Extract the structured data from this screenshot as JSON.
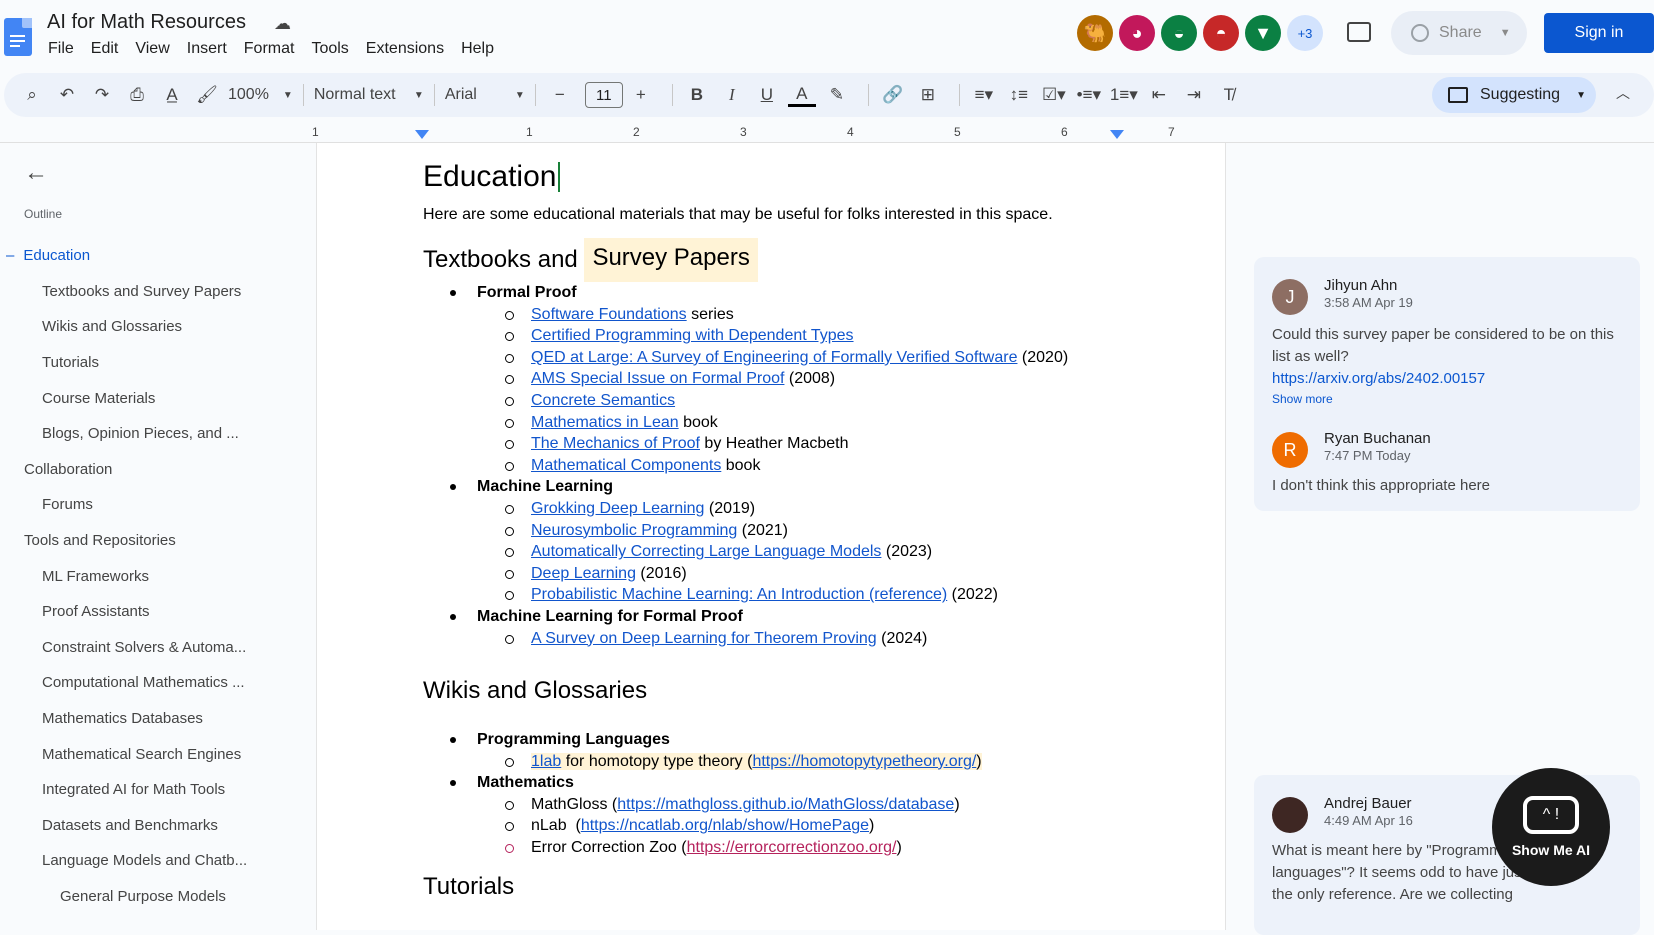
{
  "app": {
    "doc_title": "AI for Math Resources",
    "menu": [
      "File",
      "Edit",
      "View",
      "Insert",
      "Format",
      "Tools",
      "Extensions",
      "Help"
    ],
    "collaborators": [
      {
        "icon": "camel-avatar-icon",
        "color": "#b36b00"
      },
      {
        "icon": "axolotl-avatar-icon",
        "color": "#c2185b"
      },
      {
        "icon": "turtle-avatar-icon",
        "color": "#0b8043"
      },
      {
        "icon": "platypus-avatar-icon",
        "color": "#c62828"
      },
      {
        "icon": "fox-avatar-icon",
        "color": "#0b8043"
      }
    ],
    "more_collaborators": "+3",
    "share_label": "Share",
    "signin_label": "Sign in"
  },
  "toolbar": {
    "zoom": "100%",
    "style": "Normal text",
    "font": "Arial",
    "font_size": "11",
    "mode": "Suggesting"
  },
  "ruler": [
    "1",
    "1",
    "2",
    "3",
    "4",
    "5",
    "6",
    "7"
  ],
  "sidebar": {
    "outline_label": "Outline",
    "items": [
      {
        "label": "Education",
        "level": 1,
        "active": true
      },
      {
        "label": "Textbooks and Survey Papers",
        "level": 2
      },
      {
        "label": "Wikis and Glossaries",
        "level": 2
      },
      {
        "label": "Tutorials",
        "level": 2
      },
      {
        "label": "Course Materials",
        "level": 2
      },
      {
        "label": "Blogs, Opinion Pieces, and ...",
        "level": 2
      },
      {
        "label": "Collaboration",
        "level": 1
      },
      {
        "label": "Forums",
        "level": 2
      },
      {
        "label": "Tools and Repositories",
        "level": 1
      },
      {
        "label": "ML Frameworks",
        "level": 2
      },
      {
        "label": "Proof Assistants",
        "level": 2
      },
      {
        "label": "Constraint Solvers & Automa...",
        "level": 2
      },
      {
        "label": "Computational Mathematics ...",
        "level": 2
      },
      {
        "label": "Mathematics Databases",
        "level": 2
      },
      {
        "label": "Mathematical Search Engines",
        "level": 2
      },
      {
        "label": "Integrated AI for Math Tools",
        "level": 2
      },
      {
        "label": "Datasets and Benchmarks",
        "level": 2
      },
      {
        "label": "Language Models and Chatb...",
        "level": 2
      },
      {
        "label": "General Purpose Models",
        "level": 3
      }
    ]
  },
  "doc": {
    "heading": "Education",
    "intro": "Here are some educational materials that may be useful for folks interested in this space.",
    "section1": {
      "title_a": "Textbooks and ",
      "title_b": "Survey Papers",
      "formal_proof": {
        "label": "Formal Proof",
        "items": [
          {
            "link": "Software Foundations",
            "suffix": " series"
          },
          {
            "link": "Certified Programming with Dependent Types",
            "suffix": ""
          },
          {
            "link": "QED at Large: A Survey of Engineering of Formally Verified Software",
            "suffix": " (2020)"
          },
          {
            "link": "AMS Special Issue on Formal Proof",
            "suffix": " (2008)"
          },
          {
            "link": "Concrete Semantics",
            "suffix": ""
          },
          {
            "link": "Mathematics in Lean",
            "suffix": " book"
          },
          {
            "link": "The Mechanics of Proof",
            "suffix": " by Heather Macbeth"
          },
          {
            "link": "Mathematical Components",
            "suffix": " book"
          }
        ]
      },
      "ml": {
        "label": "Machine Learning",
        "items": [
          {
            "link": "Grokking Deep Learning",
            "suffix": " (2019)"
          },
          {
            "link": "Neurosymbolic Programming",
            "suffix": " (2021)"
          },
          {
            "link": "Automatically Correcting Large Language Models",
            "suffix": " (2023)"
          },
          {
            "link": "Deep Learning",
            "suffix": " (2016)"
          },
          {
            "link": "Probabilistic Machine Learning: An Introduction (reference)",
            "suffix": " (2022)"
          }
        ]
      },
      "mlfp": {
        "label": "Machine Learning for Formal Proof",
        "items": [
          {
            "link": "A Survey on Deep Learning for Theorem Proving",
            "suffix": " (2024)"
          }
        ]
      }
    },
    "section2": {
      "title": "Wikis and Glossaries",
      "pl": {
        "label": "Programming Languages",
        "item_link": "1lab",
        "item_mid": " for homotopy type theory (",
        "item_url": "https://homotopytypetheory.org/",
        "item_end": ")"
      },
      "math": {
        "label": "Mathematics",
        "items": [
          {
            "prefix": "MathGloss (",
            "url": "https://mathgloss.github.io/MathGloss/database",
            "end": ")"
          },
          {
            "prefix": "nLab  (",
            "url": "https://ncatlab.org/nlab/show/HomePage",
            "end": ")"
          },
          {
            "prefix": "Error Correction Zoo (",
            "url": "https://errorcorrectionzoo.org/",
            "end": ")",
            "suggestion": true
          }
        ]
      }
    },
    "next_heading_partial": "Tutorials"
  },
  "comments": [
    {
      "initial": "J",
      "name": "Jihyun Ahn",
      "time": "3:58 AM Apr 19",
      "text": "Could this survey paper be considered to be on this list as well?",
      "link": "https://arxiv.org/abs/2402.00157",
      "show_more": "Show more",
      "color": "#8d6e63"
    },
    {
      "initial": "R",
      "name": "Ryan Buchanan",
      "time": "7:47 PM Today",
      "text": "I don't think this appropriate here",
      "color": "#ef6c00"
    },
    {
      "initial": "",
      "name": "Andrej Bauer",
      "time": "4:49 AM Apr 16",
      "text": "What is meant here by \"Programming languages\"? It seems odd to have just 1lab as the only reference. Are we collecting",
      "color": "#3e2723"
    }
  ],
  "watermark": "Show Me AI"
}
